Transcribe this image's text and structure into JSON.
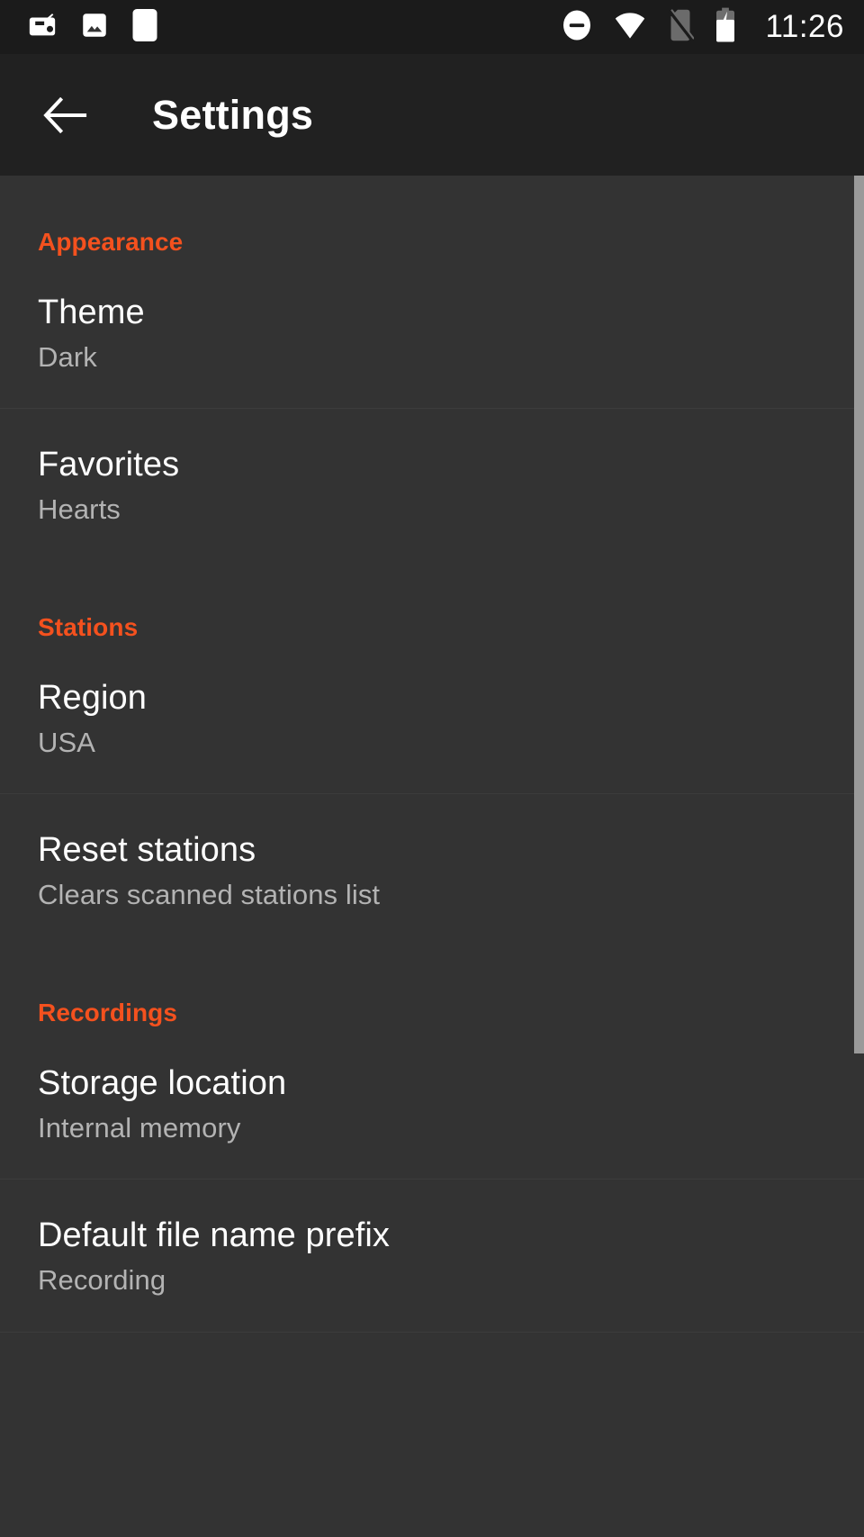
{
  "status_bar": {
    "left_icons": [
      {
        "name": "radio-icon",
        "label": "Radio"
      },
      {
        "name": "image-icon",
        "label": "Screenshot"
      },
      {
        "name": "blank-notification-icon",
        "label": "Notification"
      }
    ],
    "right_icons": [
      {
        "name": "do-not-disturb-icon",
        "label": "Do not disturb"
      },
      {
        "name": "wifi-icon",
        "label": "Wi-Fi"
      },
      {
        "name": "no-sim-icon",
        "label": "No SIM"
      },
      {
        "name": "battery-charging-icon",
        "label": "Battery charging"
      }
    ],
    "clock": "11:26"
  },
  "app_bar": {
    "back_label": "Back",
    "title": "Settings"
  },
  "colors": {
    "accent": "#f4511e",
    "app_bar_bg": "#212121",
    "status_bar_bg": "#1b1b1b",
    "content_bg": "#333333",
    "title_text": "#ffffff",
    "subtitle_text": "#b3b3b3",
    "divider": "#3c3c3c",
    "scrollbar_thumb": "#9a9a9a"
  },
  "sections": [
    {
      "header": "Appearance",
      "items": [
        {
          "title": "Theme",
          "subtitle": "Dark"
        },
        {
          "title": "Favorites",
          "subtitle": "Hearts"
        }
      ]
    },
    {
      "header": "Stations",
      "items": [
        {
          "title": "Region",
          "subtitle": "USA"
        },
        {
          "title": "Reset stations",
          "subtitle": "Clears scanned stations list"
        }
      ]
    },
    {
      "header": "Recordings",
      "items": [
        {
          "title": "Storage location",
          "subtitle": "Internal memory"
        },
        {
          "title": "Default file name prefix",
          "subtitle": "Recording"
        }
      ]
    }
  ]
}
